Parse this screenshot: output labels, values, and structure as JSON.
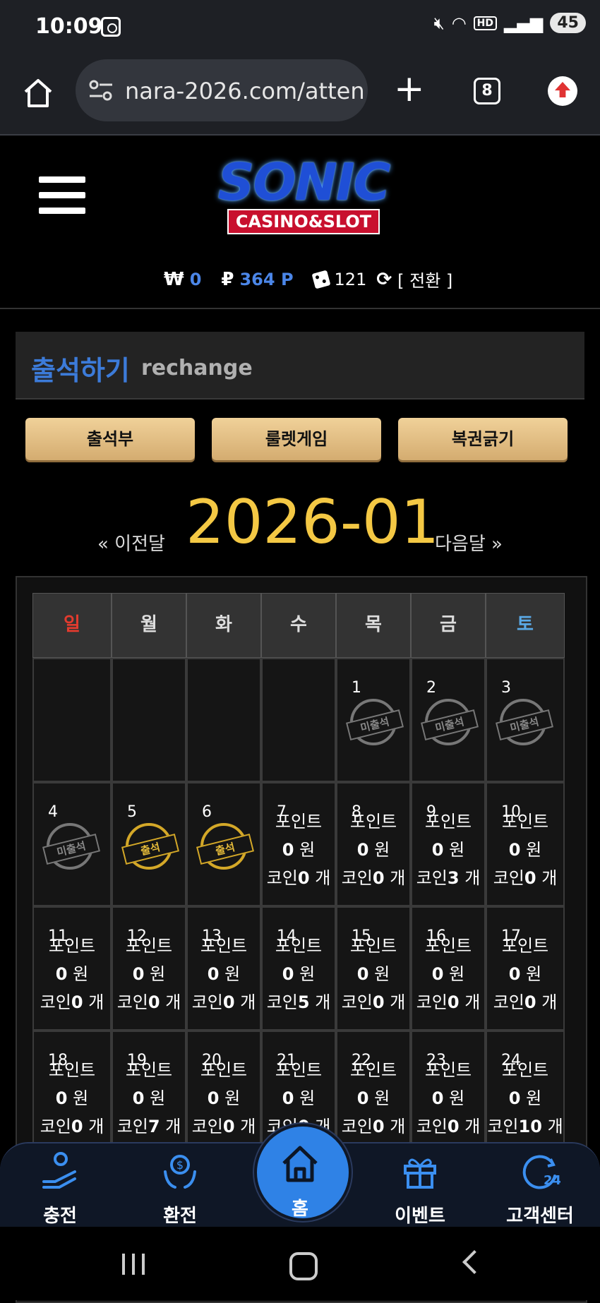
{
  "status_bar": {
    "time": "10:09",
    "battery": "45"
  },
  "browser": {
    "url": "nara-2026.com/atten",
    "tab_count": "8"
  },
  "site": {
    "logo_main": "SONIC",
    "logo_sub": "CASINO&SLOT"
  },
  "wallet": {
    "won_symbol": "₩",
    "won": "0",
    "point_symbol": "₽",
    "point": "364 P",
    "coin": "121",
    "switch_label": "[ 전환 ]"
  },
  "page": {
    "title_ko": "출석하기",
    "title_en": "rechange"
  },
  "tabs": [
    "출석부",
    "룰렛게임",
    "복권긁기"
  ],
  "month_nav": {
    "prev": "« 이전달",
    "current": "2026-01",
    "next": "다음달 »"
  },
  "calendar": {
    "weekdays": [
      "일",
      "월",
      "화",
      "수",
      "목",
      "금",
      "토"
    ],
    "weekday_colors": {
      "sunday": "#e33b2e",
      "saturday": "#5aa9e6"
    },
    "labels": {
      "point": "포인트",
      "won": "원",
      "coin": "코인",
      "count": "개"
    },
    "stamps": {
      "absent": "미출석",
      "present": "출석"
    },
    "days": [
      {
        "day": "1",
        "status": "absent"
      },
      {
        "day": "2",
        "status": "absent"
      },
      {
        "day": "3",
        "status": "absent"
      },
      {
        "day": "4",
        "status": "absent"
      },
      {
        "day": "5",
        "status": "present"
      },
      {
        "day": "6",
        "status": "present"
      },
      {
        "day": "7",
        "points": "0",
        "coins": "0"
      },
      {
        "day": "8",
        "points": "0",
        "coins": "0"
      },
      {
        "day": "9",
        "points": "0",
        "coins": "3"
      },
      {
        "day": "10",
        "points": "0",
        "coins": "0"
      },
      {
        "day": "11",
        "points": "0",
        "coins": "0"
      },
      {
        "day": "12",
        "points": "0",
        "coins": "0"
      },
      {
        "day": "13",
        "points": "0",
        "coins": "0"
      },
      {
        "day": "14",
        "points": "0",
        "coins": "5"
      },
      {
        "day": "15",
        "points": "0",
        "coins": "0"
      },
      {
        "day": "16",
        "points": "0",
        "coins": "0"
      },
      {
        "day": "17",
        "points": "0",
        "coins": "0"
      },
      {
        "day": "18",
        "points": "0",
        "coins": "0"
      },
      {
        "day": "19",
        "points": "0",
        "coins": "7"
      },
      {
        "day": "20",
        "points": "0",
        "coins": "0"
      },
      {
        "day": "21",
        "points": "0",
        "coins": "0"
      },
      {
        "day": "22",
        "points": "0",
        "coins": "0"
      },
      {
        "day": "23",
        "points": "0",
        "coins": "0"
      },
      {
        "day": "24",
        "points": "0",
        "coins": "10"
      }
    ]
  },
  "bottom_nav": {
    "deposit": "충전",
    "withdraw": "환전",
    "home": "홈",
    "event": "이벤트",
    "support": "고객센터"
  }
}
